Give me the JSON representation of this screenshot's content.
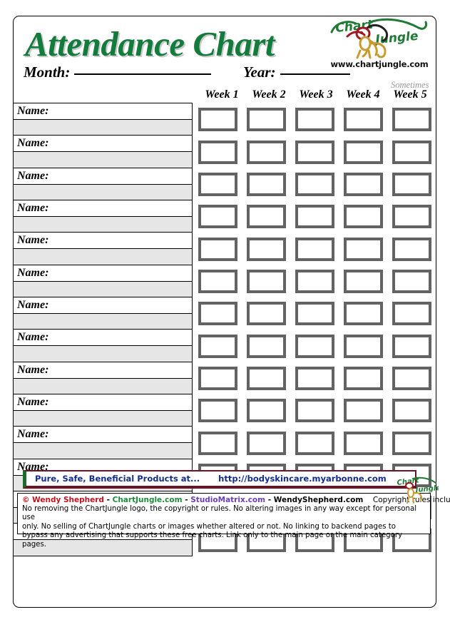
{
  "document": {
    "title": "Attendance Chart",
    "title_color": "#137b3b"
  },
  "header": {
    "month_label": "Month:",
    "year_label": "Year:",
    "sometimes_label": "Sometimes",
    "logo_alt": "chartjungle-logo",
    "logo_text_top": "Chart",
    "logo_text_bottom": "Jungle",
    "website": "www.chartjungle.com"
  },
  "table": {
    "week_columns": [
      "Week 1",
      "Week 2",
      "Week 3",
      "Week 4",
      "Week 5"
    ],
    "row_label": "Name:",
    "row_count": 14,
    "checkbox_border_color": "#636363",
    "blank_row_fill": "#e6e6e6"
  },
  "advert": {
    "tagline": "Pure, Safe, Beneficial Products at...",
    "url": "http://bodyskincare.myarbonne.com",
    "text_color": "#142c8e",
    "accent_left": "#1c6b2e",
    "accent_border": "#6d1326"
  },
  "footer": {
    "copyright_symbol": "©",
    "owner": "Wendy Shepherd",
    "sep": "-",
    "link_chartjungle": "ChartJungle.com",
    "link_studiomatrix": "StudioMatrix.com",
    "link_wendyshepherd": "WendyShepherd.com",
    "rules_intro": "Copyright rules include:",
    "rules_line1": "No removing the ChartJungle logo, the copyright or rules. No altering images in any way except for personal use",
    "rules_line2": "only. No selling of ChartJungle charts or images whether altered or not. No linking to backend pages to",
    "rules_line3": "bypass any advertising that supports these free charts. Link only to the main page or the main category pages."
  }
}
